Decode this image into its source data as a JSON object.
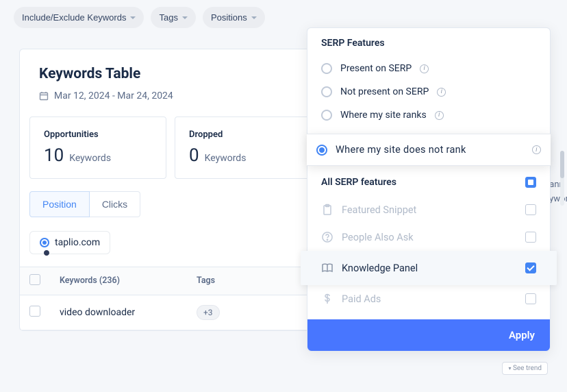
{
  "filterBar": {
    "includeExclude": "Include/Exclude Keywords",
    "tags": "Tags",
    "positions": "Positions"
  },
  "card": {
    "title": "Keywords Table",
    "dateRange": "Mar 12, 2024 - Mar 24, 2024"
  },
  "stats": {
    "opportunities": {
      "label": "Opportunities",
      "value": "10",
      "sub": "Keywords"
    },
    "dropped": {
      "label": "Dropped",
      "value": "0",
      "sub": "Keywords"
    }
  },
  "tabs": {
    "position": "Position",
    "clicks": "Clicks"
  },
  "domain": "taplio.com",
  "table": {
    "headers": {
      "keywords": "Keywords (236)",
      "tags": "Tags"
    },
    "rows": [
      {
        "keyword": "video downloader",
        "tag": "+3"
      }
    ]
  },
  "dropdown": {
    "title": "SERP Features",
    "radios": [
      "Present on SERP",
      "Not present on SERP",
      "Where my site ranks",
      "Where my site does not rank"
    ],
    "allFeatures": "All SERP features",
    "features": {
      "featuredSnippet": "Featured Snippet",
      "peopleAlsoAsk": "People Also Ask",
      "knowledgePanel": "Knowledge Panel",
      "paidAds": "Paid Ads"
    },
    "apply": "Apply"
  },
  "partial": {
    "ann": "ann",
    "ywor": "ywor"
  },
  "seeTrend": "See trend"
}
